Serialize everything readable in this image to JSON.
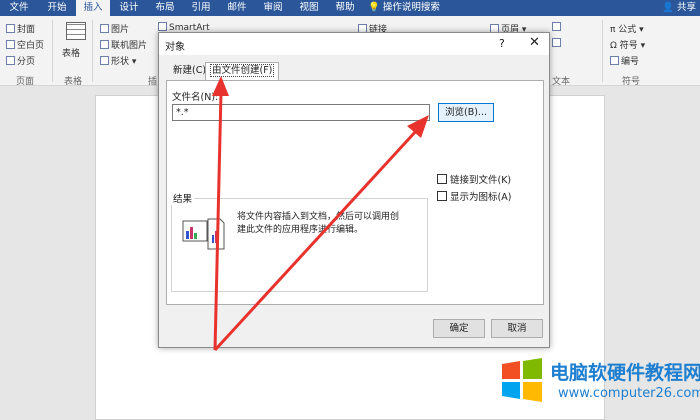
{
  "ribbon": {
    "tabs": [
      "文件",
      "开始",
      "插入",
      "设计",
      "布局",
      "引用",
      "邮件",
      "审阅",
      "视图",
      "帮助"
    ],
    "active_tab": "插入",
    "tell_me": "操作说明搜索",
    "share": "共享",
    "pages_group": {
      "items": [
        "封面",
        "空白页",
        "分页"
      ],
      "label": "页面"
    },
    "table_group": {
      "item": "表格",
      "label": "表格"
    },
    "illustrations": {
      "items": [
        "图片",
        "联机图片",
        "形状"
      ],
      "label": "插"
    },
    "smartart": "SmartArt",
    "link": "链接",
    "header": "页眉",
    "text_label": "文本",
    "symbols": {
      "items": [
        "公式",
        "符号",
        "编号"
      ],
      "label": "符号"
    }
  },
  "dialog": {
    "title": "对象",
    "help": "?",
    "close": "✕",
    "tabs": {
      "new": "新建(C)",
      "from_file": "由文件创建(F)"
    },
    "filename_label": "文件名(N):",
    "filename_value": "*.*",
    "browse": "浏览(B)...",
    "link_to_file": "链接到文件(K)",
    "display_as_icon": "显示为图标(A)",
    "result_label": "结果",
    "result_text": "将文件内容插入到文档，然后可以调用创建此文件的应用程序进行编辑。",
    "ok": "确定",
    "cancel": "取消"
  },
  "watermark": {
    "title": "电脑软硬件教程网",
    "url": "www.computer26.com"
  },
  "colors": {
    "ribbon_blue": "#2b579a",
    "arrow_red": "#e8322d",
    "watermark_blue": "#1e7fd0"
  }
}
